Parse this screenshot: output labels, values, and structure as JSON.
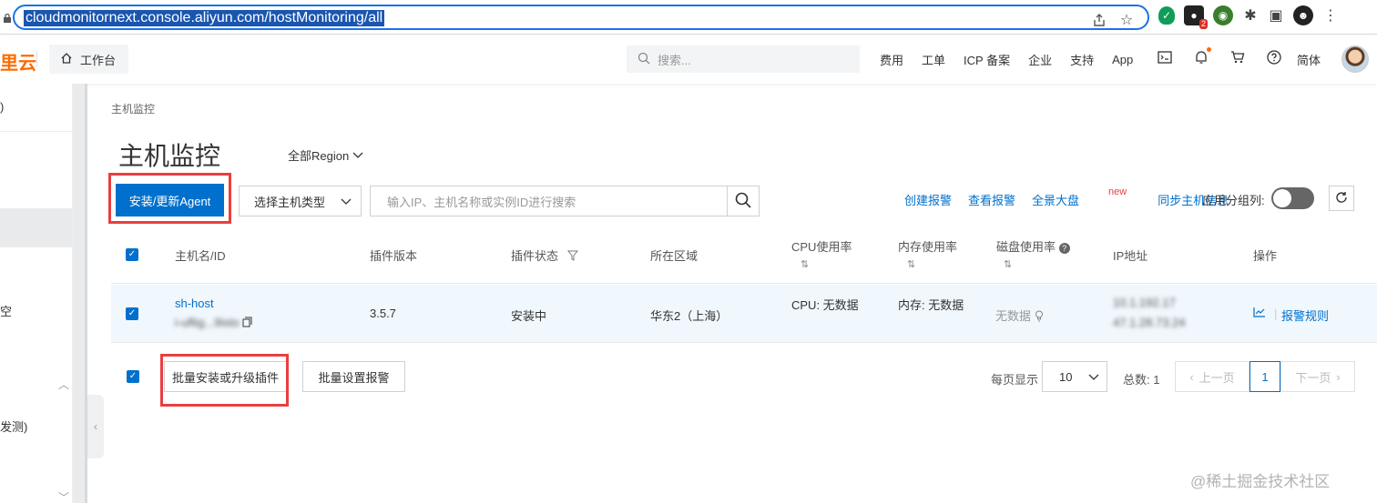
{
  "browser": {
    "url": "cloudmonitornext.console.aliyun.com/hostMonitoring/all",
    "extension_badge": "2"
  },
  "header": {
    "logo": "里云",
    "workbench": "工作台",
    "search_placeholder": "搜索...",
    "nav_items": [
      "费用",
      "工单",
      "ICP 备案",
      "企业",
      "支持",
      "App"
    ],
    "lang": "简体"
  },
  "sidebar": {
    "paren_text": ")",
    "text1": "空",
    "text2": "发测)"
  },
  "page": {
    "breadcrumb": "主机监控",
    "title": "主机监控",
    "region": "全部Region"
  },
  "toolbar": {
    "install_button": "安装/更新Agent",
    "host_type_select": "选择主机类型",
    "search_placeholder": "输入IP、主机名称或实例ID进行搜索",
    "links": {
      "create_alarm": "创建报警",
      "view_alarm": "查看报警",
      "dashboard": "全景大盘",
      "new_tag": "new",
      "sync_info": "同步主机信息"
    },
    "group_label": "应用分组列:"
  },
  "table": {
    "headers": {
      "host": "主机名/ID",
      "plugin_version": "插件版本",
      "plugin_status": "插件状态",
      "region": "所在区域",
      "cpu": "CPU使用率",
      "memory": "内存使用率",
      "disk": "磁盘使用率",
      "ip": "IP地址",
      "ops": "操作"
    },
    "rows": [
      {
        "host_name": "sh-host",
        "host_id": "i-uf6g...9isto",
        "plugin_version": "3.5.7",
        "plugin_status": "安装中",
        "region": "华东2（上海）",
        "cpu": "CPU: 无数据",
        "memory": "内存: 无数据",
        "disk": "无数据",
        "ip_1": "10.1.192.17",
        "ip_2": "47.1.28.73.24",
        "alarm_rules": "报警规则"
      }
    ]
  },
  "footer": {
    "batch_install": "批量安装或升级插件",
    "batch_alarm": "批量设置报警",
    "per_page_label": "每页显示",
    "per_page_value": "10",
    "total": "总数: 1",
    "prev": "上一页",
    "current_page": "1",
    "next": "下一页"
  },
  "watermark": "@稀土掘金技术社区",
  "colors": {
    "primary": "#0070cc",
    "brand": "#ff6a00",
    "highlight": "#e93f3f"
  }
}
